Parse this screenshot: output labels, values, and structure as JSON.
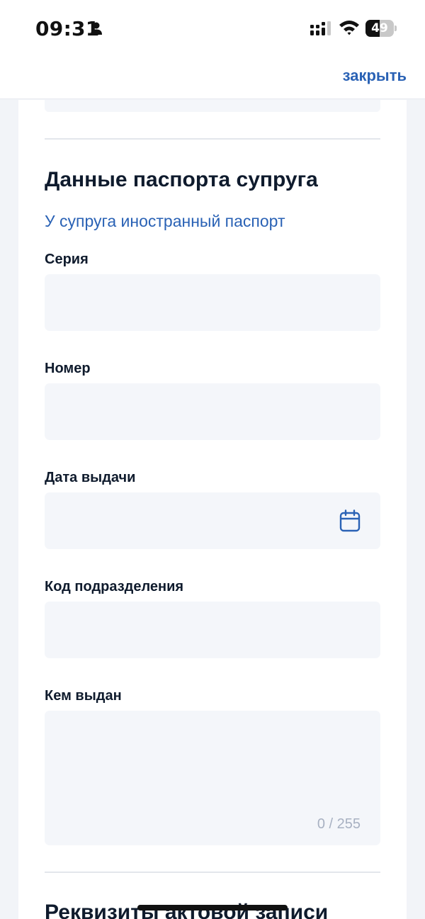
{
  "status_bar": {
    "time": "09:31",
    "battery_level": "49",
    "battery_fraction": 0.49
  },
  "nav": {
    "close_label": "закрыть"
  },
  "section": {
    "title": "Данные паспорта супруга",
    "foreign_passport_link": "У супруга иностранный паспорт"
  },
  "fields": {
    "series_label": "Серия",
    "series_value": "",
    "number_label": "Номер",
    "number_value": "",
    "issue_date_label": "Дата выдачи",
    "issue_date_value": "",
    "division_code_label": "Код подразделения",
    "division_code_value": "",
    "issued_by_label": "Кем выдан",
    "issued_by_counter": "0 / 255"
  },
  "next_section": {
    "title": "Реквизиты актовой записи"
  },
  "icons": {
    "calendar": "calendar-icon",
    "person": "person-icon",
    "signal": "signal-icon",
    "wifi": "wifi-icon"
  },
  "colors": {
    "accent": "#2a62b5",
    "text": "#0f1b2d",
    "field_bg": "#f4f6fa",
    "page_bg": "#f2f4f8"
  }
}
